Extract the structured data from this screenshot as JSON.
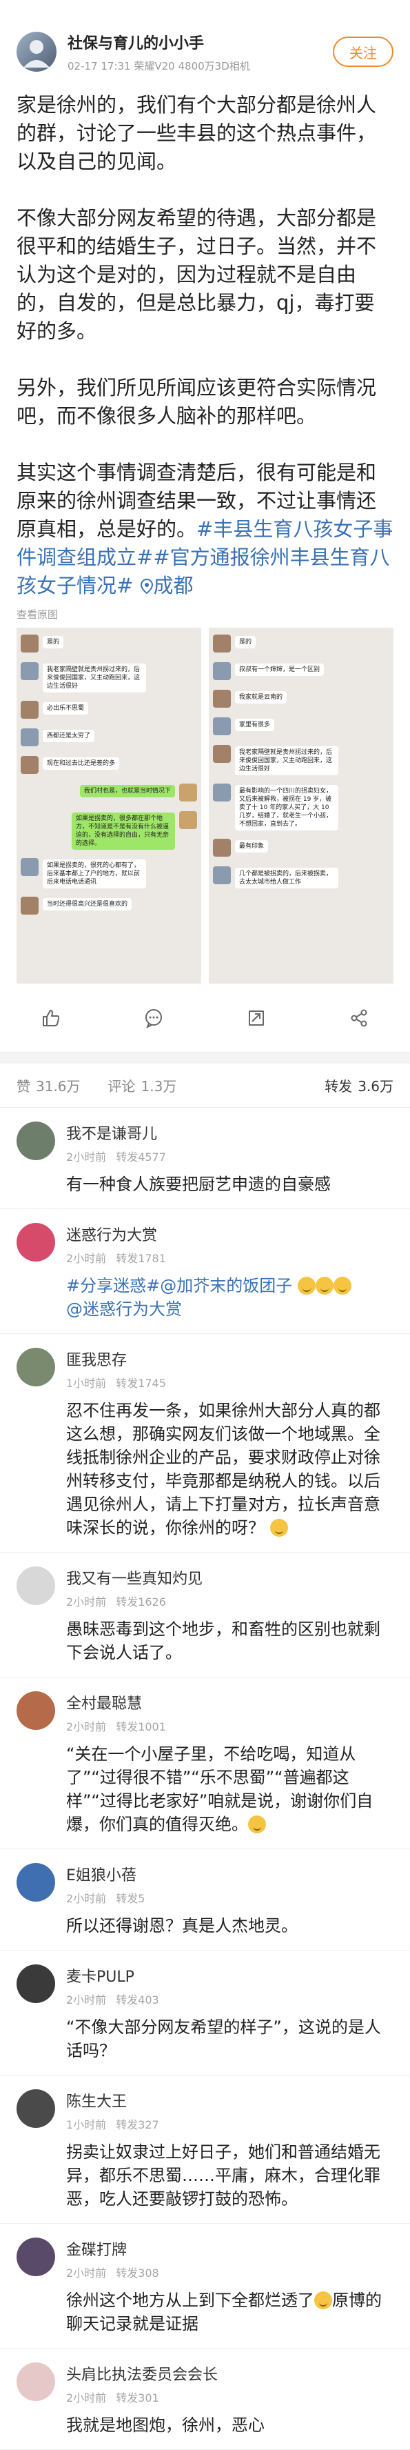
{
  "post": {
    "author": "社保与育儿的小小手",
    "time": "02-17 17:31",
    "device": "荣耀V20 4800万3D相机",
    "follow_label": "关注",
    "paragraphs": [
      "家是徐州的，我们有个大部分都是徐州人的群，讨论了一些丰县的这个热点事件，以及自己的见闻。",
      "不像大部分网友希望的待遇，大部分都是很平和的结婚生子，过日子。当然，并不认为这个是对的，因为过程就不是自由的，自发的，但是总比暴力，qj，毒打要好的多。",
      "另外，我们所见所闻应该更符合实际情况吧，而不像很多人脑补的那样吧。"
    ],
    "last_paragraph_text": "其实这个事情调查清楚后，很有可能是和原来的徐州调查结果一致，不过让事情还原真相，总是好的。",
    "tag1": "#丰县生育八孩女子事件调查组成立#",
    "tag2": "#官方通报徐州丰县生育八孩女子情况#",
    "location": "成都",
    "image_caption": "查看原图"
  },
  "chat_left": [
    {
      "text": "是的",
      "side": "left"
    },
    {
      "text": "我老家隔壁就是贵州拐过来的，后来俊俊回国家，又主动跑回来，这边生活很好",
      "side": "left"
    },
    {
      "text": "必出乐不思蜀",
      "side": "left"
    },
    {
      "text": "西都还是太穷了",
      "side": "left"
    },
    {
      "text": "现在和过去比还是差的多",
      "side": "left"
    },
    {
      "text": "我们村也是，也就是当时情况下",
      "side": "right"
    },
    {
      "text": "如果是拐卖的，很多都在那个地方，不知道是不是有没有什么被逼迫的，没有选择的自由，只有无奈的选择。",
      "side": "right"
    },
    {
      "text": "如果是拐卖的，很死的心都有了，后来基本都上了户的地方，就以前后来电话电话通讯",
      "side": "left"
    },
    {
      "text": "当时还得很高兴还是很喜欢的",
      "side": "left"
    }
  ],
  "chat_right": [
    {
      "text": "是的",
      "side": "left"
    },
    {
      "text": "叔叔有一个婶婶，是一个区别",
      "side": "left"
    },
    {
      "text": "我家就是云南的",
      "side": "left"
    },
    {
      "text": "家里有很多",
      "side": "left"
    },
    {
      "text": "我老家隔壁就是贵州拐过来的，后来俊俊回国家，又主动跑回来，这边生活很好",
      "side": "left"
    },
    {
      "text": "最有影响的一个四川的拐卖妇女，又后来被解救，被拐在 19 岁，被卖了十 10 年的家人买了，大 10 几岁，结婚了，就老生一个小孩，不想回家，直到去了。",
      "side": "left"
    },
    {
      "text": "最有印象",
      "side": "left"
    },
    {
      "text": "几个都是被拐卖的，后来被拐卖，去太太城市给人做工作",
      "side": "left"
    }
  ],
  "actions": {
    "like_icon": "thumb-up-icon",
    "comment_icon": "comment-icon",
    "repost_icon": "repost-icon",
    "share_icon": "share-icon"
  },
  "tabs": {
    "likes_label": "赞",
    "likes_count": "31.6万",
    "comments_label": "评论",
    "comments_count": "1.3万",
    "reposts_label": "转发",
    "reposts_count": "3.6万"
  },
  "comments": [
    {
      "name": "我不是谦哥儿",
      "time": "2小时前",
      "reposts": "转发4577",
      "text": "有一种食人族要把厨艺申遗的自豪感",
      "avatar": "#6d7f6a"
    },
    {
      "name": "迷惑行为大赏",
      "time": "2小时前",
      "reposts": "转发1781",
      "tag": "#分享迷惑#",
      "text_mid": "@加芥末的饭团子 ",
      "text_end": "@迷惑行为大赏",
      "avatar": "#d74b6a"
    },
    {
      "name": "匪我思存",
      "time": "1小时前",
      "reposts": "转发1745",
      "text": "忍不住再发一条，如果徐州大部分人真的都这么想，那确实网友们该做一个地域黑。全线抵制徐州企业的产品，要求财政停止对徐州转移支付，毕竟那都是纳税人的钱。以后遇见徐州人，请上下打量对方，拉长声音意味深长的说，你徐州的呀？",
      "avatar": "#7a8a6e"
    },
    {
      "name": "我又有一些真知灼见",
      "time": "2小时前",
      "reposts": "转发1626",
      "text": "愚昧恶毒到这个地步，和畜牲的区别也就剩下会说人话了。",
      "avatar": "#d8d8d8"
    },
    {
      "name": "全村最聪慧",
      "time": "2小时前",
      "reposts": "转发1001",
      "text": "“关在一个小屋子里，不给吃喝，知道从了”“过得很不错”“乐不思蜀”“普遍都这样”“过得比老家好”咱就是说，谢谢你们自爆，你们真的值得灭绝。",
      "avatar": "#b56a4a"
    },
    {
      "name": "E姐狼小蓓",
      "time": "2小时前",
      "reposts": "转发5",
      "text": "所以还得谢恩？真是人杰地灵。",
      "avatar": "#3f6fb0"
    },
    {
      "name": "麦卡PULP",
      "time": "2小时前",
      "reposts": "转发403",
      "text": "“不像大部分网友希望的样子”，这说的是人话吗？",
      "avatar": "#3a3a3a"
    },
    {
      "name": "陈生大王",
      "time": "1小时前",
      "reposts": "转发327",
      "text": "拐卖让奴隶过上好日子，她们和普通结婚无异，都乐不思蜀……平庸，麻木，合理化罪恶，吃人还要敲锣打鼓的恐怖。",
      "avatar": "#4a4a4a"
    },
    {
      "name": "金碟打牌",
      "time": "2小时前",
      "reposts": "转发308",
      "text_pre": "徐州这个地方从上到下全都烂透了",
      "text_post": "原博的聊天记录就是证据",
      "avatar": "#5a4a6a"
    },
    {
      "name": "头肩比执法委员会会长",
      "time": "2小时前",
      "reposts": "转发301",
      "text": "我就是地图炮，徐州，恶心",
      "avatar": "#e7c8c8"
    }
  ]
}
